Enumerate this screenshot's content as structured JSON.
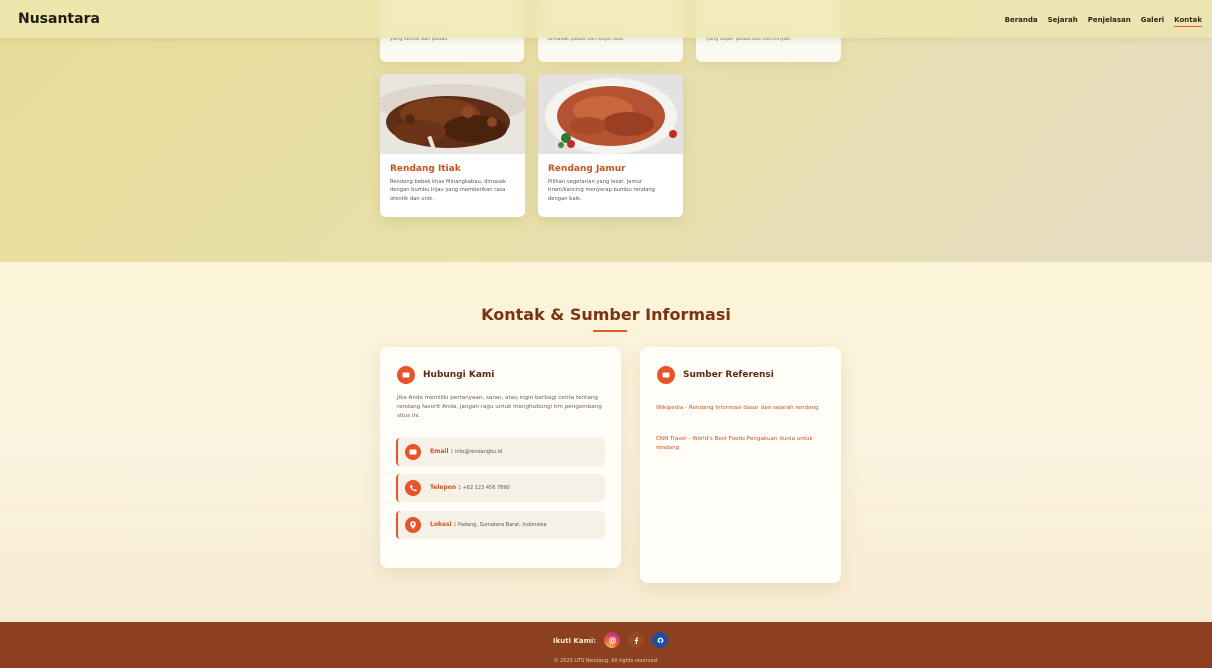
{
  "brand": "Nusantara",
  "nav": {
    "items": [
      "Beranda",
      "Sejarah",
      "Penjelasan",
      "Galeri",
      "Kontak"
    ],
    "active": "Kontak"
  },
  "gallery_top": [
    {
      "desc": "yang kental dan pedas."
    },
    {
      "desc": "dimasak pedas dan kaya rasa."
    },
    {
      "desc": "yang super pedas dan berminyak."
    }
  ],
  "gallery": [
    {
      "title": "Rendang Itiak",
      "desc": "Rendang bebek khas Minangkabau, dimasak dengan bumbu hijau yang memberikan rasa otentik dan unik.",
      "image": "duck-rendang-photo"
    },
    {
      "title": "Rendang Jamur",
      "desc": "Pilihan vegetarian yang lezat. Jamur tiram/kancing menyerap bumbu rendang dengan baik.",
      "image": "mushroom-rendang-photo"
    }
  ],
  "contact": {
    "section_title": "Kontak & Sumber Informasi",
    "hubungi": {
      "title": "Hubungi Kami",
      "text": "Jika Anda memiliki pertanyaan, saran, atau ingin berbagi cerita tentang rendang favorit Anda, jangan ragu untuk menghubungi tim pengembang situs ini.",
      "items": [
        {
          "label": "Email :",
          "value": "info@rendangku.id",
          "icon": "mail-icon"
        },
        {
          "label": "Telepon :",
          "value": "+62 123 456 7890",
          "icon": "phone-icon"
        },
        {
          "label": "Lokasi :",
          "value": "Padang, Sumatera Barat, Indonesia",
          "icon": "location-pin-icon"
        }
      ]
    },
    "sumber": {
      "title": "Sumber Referensi",
      "links": [
        "Wikipedia - Rendang Informasi dasar dan sejarah rendang",
        "CNN Travel - World's Best Foods Pengakuan dunia untuk rendang"
      ]
    }
  },
  "footer": {
    "follow_label": "Ikuti Kami:",
    "social": [
      "instagram-icon",
      "facebook-icon",
      "github-icon"
    ],
    "copyright": "© 2025 UTS Rendang. All rights reserved."
  },
  "colors": {
    "accent": "#e8542a",
    "heading": "#7a3414",
    "footer": "#8b4020"
  }
}
